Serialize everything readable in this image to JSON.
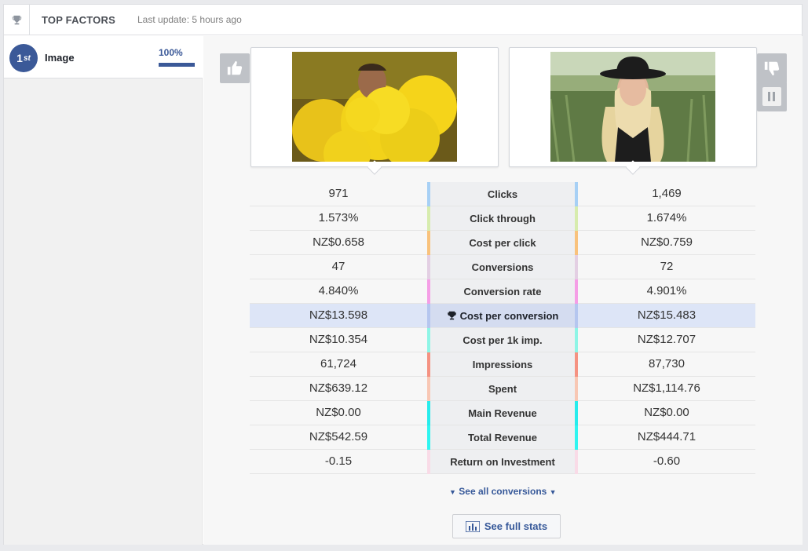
{
  "header": {
    "title": "TOP FACTORS",
    "last_update": "Last update: 5 hours ago",
    "icon": "trophy-icon"
  },
  "sidebar": {
    "items": [
      {
        "rank": "1",
        "rank_suffix": "st",
        "label": "Image",
        "percent": "100%",
        "fill": 1.0
      }
    ]
  },
  "comparison": {
    "rows": [
      {
        "label": "Clicks",
        "left": "971",
        "right": "1,469",
        "color": "#a7d0f5"
      },
      {
        "label": "Click through",
        "left": "1.573%",
        "right": "1.674%",
        "color": "#d7ecae"
      },
      {
        "label": "Cost per click",
        "left": "NZ$0.658",
        "right": "NZ$0.759",
        "color": "#f9c27c"
      },
      {
        "label": "Conversions",
        "left": "47",
        "right": "72",
        "color": "#e3cfe3"
      },
      {
        "label": "Conversion rate",
        "left": "4.840%",
        "right": "4.901%",
        "color": "#f59ee6"
      },
      {
        "label": "Cost per conversion",
        "left": "NZ$13.598",
        "right": "NZ$15.483",
        "color": "#b5c6ef",
        "highlight": true
      },
      {
        "label": "Cost per 1k imp.",
        "left": "NZ$10.354",
        "right": "NZ$12.707",
        "color": "#8ef5e6"
      },
      {
        "label": "Impressions",
        "left": "61,724",
        "right": "87,730",
        "color": "#f59282"
      },
      {
        "label": "Spent",
        "left": "NZ$639.12",
        "right": "NZ$1,114.76",
        "color": "#f8c7b4"
      },
      {
        "label": "Main Revenue",
        "left": "NZ$0.00",
        "right": "NZ$0.00",
        "color": "#27ecec"
      },
      {
        "label": "Total Revenue",
        "left": "NZ$542.59",
        "right": "NZ$444.71",
        "color": "#2ff5f0"
      },
      {
        "label": "Return on Investment",
        "left": "-0.15",
        "right": "-0.60",
        "color": "#f9dbe7"
      }
    ]
  },
  "links": {
    "see_all": "See all conversions"
  },
  "buttons": {
    "full_stats": "See full stats"
  },
  "colors": {
    "brand": "#3b5998",
    "link": "#365899",
    "highlight_row": "#dde5f7"
  }
}
